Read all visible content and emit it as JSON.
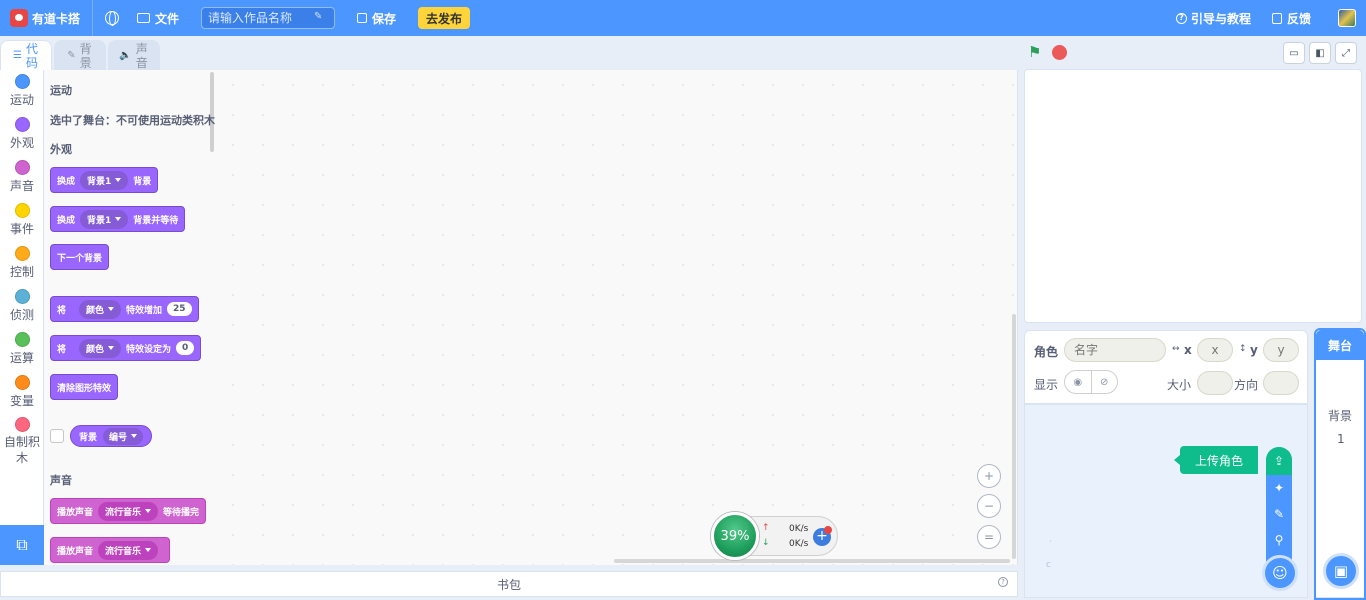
{
  "menubar": {
    "app_name": "有道卡搭",
    "file_label": "文件",
    "title_placeholder": "请输入作品名称",
    "save_label": "保存",
    "publish_label": "去发布",
    "guide_label": "引导与教程",
    "feedback_label": "反馈"
  },
  "tabs": [
    {
      "label": "代码",
      "icon": "code-icon"
    },
    {
      "label": "背景",
      "icon": "brush-icon"
    },
    {
      "label": "声音",
      "icon": "speaker-icon"
    }
  ],
  "categories": [
    {
      "label": "运动",
      "color": "#4c97ff"
    },
    {
      "label": "外观",
      "color": "#9966ff"
    },
    {
      "label": "声音",
      "color": "#cf63cf"
    },
    {
      "label": "事件",
      "color": "#ffd500"
    },
    {
      "label": "控制",
      "color": "#ffab19"
    },
    {
      "label": "侦测",
      "color": "#5cb1d6"
    },
    {
      "label": "运算",
      "color": "#59c059"
    },
    {
      "label": "变量",
      "color": "#ff8c1a"
    },
    {
      "label": "自制积木",
      "color": "#ff6680"
    }
  ],
  "palette": {
    "motion_heading": "运动",
    "motion_note": "选中了舞台：不可使用运动类积木",
    "looks_heading": "外观",
    "sound_heading": "声音",
    "blocks": {
      "switch_backdrop": {
        "prefix": "换成",
        "menu": "背景1",
        "suffix": "背景"
      },
      "switch_backdrop_wait": {
        "prefix": "换成",
        "menu": "背景1",
        "suffix": "背景并等待"
      },
      "next_backdrop": "下一个背景",
      "change_effect": {
        "prefix": "将",
        "menu": "颜色",
        "middle": "特效增加",
        "value": "25"
      },
      "set_effect": {
        "prefix": "将",
        "menu": "颜色",
        "middle": "特效设定为",
        "value": "0"
      },
      "clear_effects": "清除图形特效",
      "backdrop_reporter": {
        "prefix": "背景",
        "menu": "编号"
      },
      "play_sound_wait": {
        "prefix": "播放声音",
        "menu": "流行音乐",
        "suffix": "等待播完"
      },
      "play_sound": {
        "prefix": "播放声音",
        "menu": "流行音乐"
      }
    }
  },
  "network": {
    "percent": "39%",
    "up_speed": "0K/s",
    "down_speed": "0K/s"
  },
  "backpack_label": "书包",
  "sprite_info": {
    "sprite_label": "角色",
    "name_placeholder": "名字",
    "x_label": "x",
    "x_placeholder": "x",
    "y_label": "y",
    "y_placeholder": "y",
    "show_label": "显示",
    "size_label": "大小",
    "direction_label": "方向"
  },
  "sprite_list": {
    "upload_tip": "上传角色"
  },
  "stage_pane": {
    "title": "舞台",
    "backdrop_label": "背景",
    "backdrop_count": "1"
  }
}
